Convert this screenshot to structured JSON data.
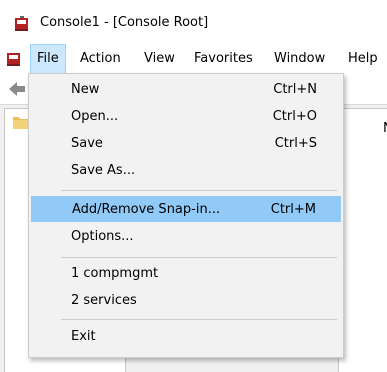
{
  "window": {
    "title": "Console1 - [Console Root]"
  },
  "menubar": {
    "items": [
      {
        "label": "File",
        "active": true
      },
      {
        "label": "Action"
      },
      {
        "label": "View"
      },
      {
        "label": "Favorites"
      },
      {
        "label": "Window"
      },
      {
        "label": "Help"
      }
    ]
  },
  "file_menu": {
    "items": [
      {
        "label": "New",
        "shortcut": "Ctrl+N"
      },
      {
        "label": "Open...",
        "shortcut": "Ctrl+O"
      },
      {
        "label": "Save",
        "shortcut": "Ctrl+S"
      },
      {
        "label": "Save As...",
        "shortcut": ""
      },
      {
        "label": "Add/Remove Snap-in...",
        "shortcut": "Ctrl+M",
        "highlighted": true
      },
      {
        "label": "Options...",
        "shortcut": ""
      },
      {
        "label": "1 compmgmt",
        "shortcut": ""
      },
      {
        "label": "2 services",
        "shortcut": ""
      },
      {
        "label": "Exit",
        "shortcut": ""
      }
    ]
  },
  "right_pane": {
    "partial_text": "N"
  },
  "colors": {
    "menu_active_bg": "#cce8ff",
    "menu_item_highlight": "#91c9f7",
    "window_bg": "#f0f0f0"
  },
  "icons": {
    "app": "mmc-console-icon",
    "back": "back-arrow-icon",
    "tree_root": "folder-icon"
  }
}
